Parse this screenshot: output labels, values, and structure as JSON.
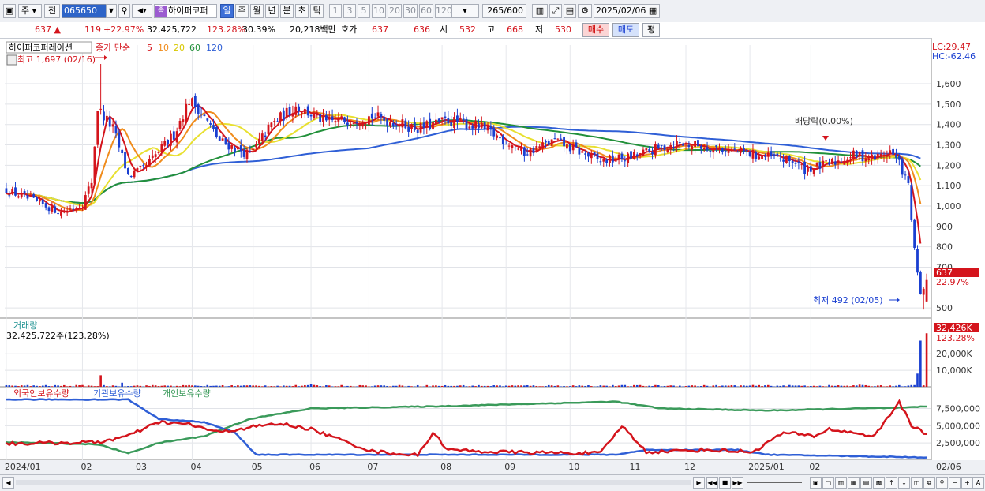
{
  "toolbar": {
    "market_label": "주",
    "board_label": "전",
    "stock_code": "065650",
    "name_tag": "종",
    "stock_name": "하이퍼코퍼",
    "periods": [
      "일",
      "주",
      "월",
      "년",
      "분",
      "초",
      "틱"
    ],
    "selected_period": "일",
    "intervals": [
      "1",
      "3",
      "5",
      "10",
      "20",
      "30",
      "60",
      "120"
    ],
    "count_value": "265",
    "count_total": "/600",
    "date_value": "2025/02/06"
  },
  "infobar": {
    "price": "637 ▲",
    "change": "119",
    "change_rate": "+22.97%",
    "volume": "32,425,722",
    "volume_ratio": "123.28%",
    "turnover": "30.39%",
    "amount": "20,218백만",
    "quote_label": "호가",
    "ask": "637",
    "bid": "636",
    "open_label": "시",
    "open": "532",
    "high_label": "고",
    "high": "668",
    "low_label": "저",
    "low": "530",
    "buy_label": "매수",
    "sell_label": "매도",
    "eval_label": "평"
  },
  "colors": {
    "up": "#d4141c",
    "down": "#1a3fd1",
    "ma5": "#d4141c",
    "ma10": "#f08c1c",
    "ma20": "#e8e030",
    "ma60": "#22903a",
    "ma120": "#2f5fd6",
    "foreign": "#d4141c",
    "institution": "#2f5fd6",
    "individual": "#3a9a5a"
  },
  "chart_data": [
    {
      "type": "candlestick",
      "title": "하이퍼코퍼레이션",
      "ma_label": "종가 단순",
      "ma_periods": [
        "5",
        "10",
        "20",
        "60",
        "120"
      ],
      "ylim": [
        450,
        1790
      ],
      "yticks": [
        "1,600",
        "1,500",
        "1,400",
        "1,300",
        "1,200",
        "1,100",
        "1,000",
        "900",
        "800",
        "700",
        "500"
      ],
      "ytick_values": [
        1600,
        1500,
        1400,
        1300,
        1200,
        1100,
        1000,
        900,
        800,
        700,
        500
      ],
      "lc_label": "LC:29.47",
      "hc_label": "HC:-62.46",
      "last_price_label": "637",
      "last_rate_label": "22.97%",
      "max_annotation": "최고 1,697 (02/16)",
      "min_annotation": "최저 492 (02/05)",
      "dividend_annotation": "배당락(0.00%)",
      "price_keypoints": [
        [
          0,
          1080
        ],
        [
          8,
          1030
        ],
        [
          18,
          970
        ],
        [
          25,
          1010
        ],
        [
          28,
          1120
        ],
        [
          30,
          1480
        ],
        [
          35,
          1380
        ],
        [
          40,
          1150
        ],
        [
          45,
          1180
        ],
        [
          55,
          1350
        ],
        [
          60,
          1520
        ],
        [
          63,
          1480
        ],
        [
          70,
          1320
        ],
        [
          80,
          1250
        ],
        [
          87,
          1400
        ],
        [
          95,
          1490
        ],
        [
          105,
          1410
        ],
        [
          120,
          1440
        ],
        [
          135,
          1380
        ],
        [
          145,
          1420
        ],
        [
          155,
          1390
        ],
        [
          165,
          1310
        ],
        [
          170,
          1260
        ],
        [
          180,
          1320
        ],
        [
          195,
          1220
        ],
        [
          205,
          1240
        ],
        [
          220,
          1310
        ],
        [
          235,
          1280
        ],
        [
          250,
          1240
        ],
        [
          258,
          1220
        ],
        [
          262,
          1180
        ],
        [
          270,
          1205
        ],
        [
          278,
          1250
        ],
        [
          285,
          1235
        ],
        [
          290,
          1270
        ],
        [
          293,
          1210
        ],
        [
          296,
          1100
        ],
        [
          298,
          780
        ],
        [
          300,
          560
        ],
        [
          302,
          637
        ]
      ]
    },
    {
      "type": "bar",
      "title": "거래량",
      "volume_label": "32,425,722주(123.28%)",
      "yticks": [
        "20,000K",
        "10,000K"
      ],
      "ytick_values": [
        20000,
        10000
      ],
      "ylim": [
        0,
        33500
      ],
      "last_volume_label": "32,426K",
      "last_ratio_label": "123.28%",
      "spikes": [
        [
          31,
          7000
        ],
        [
          38,
          2500
        ],
        [
          100,
          1800
        ],
        [
          280,
          1300
        ],
        [
          299,
          8000
        ],
        [
          300,
          28000
        ],
        [
          302,
          32426
        ]
      ]
    },
    {
      "type": "line",
      "series_labels": [
        "외국인보유수량",
        "기관보유수량",
        "개인보유수량"
      ],
      "yticks": [
        "7,500,000",
        "5,000,000",
        "2,500,000"
      ],
      "ytick_values": [
        7500000,
        5000000,
        2500000
      ],
      "ylim": [
        0,
        9500000
      ],
      "foreign_keypoints": [
        [
          0,
          2400000
        ],
        [
          30,
          2600000
        ],
        [
          40,
          3500000
        ],
        [
          50,
          5500000
        ],
        [
          60,
          5200000
        ],
        [
          70,
          4000000
        ],
        [
          80,
          4800000
        ],
        [
          90,
          5300000
        ],
        [
          100,
          4500000
        ],
        [
          120,
          1300000
        ],
        [
          135,
          700000
        ],
        [
          140,
          4000000
        ],
        [
          145,
          1500000
        ],
        [
          160,
          1200000
        ],
        [
          175,
          1100000
        ],
        [
          195,
          1000000
        ],
        [
          202,
          5000000
        ],
        [
          210,
          1200000
        ],
        [
          230,
          1500000
        ],
        [
          245,
          1200000
        ],
        [
          255,
          4000000
        ],
        [
          265,
          3500000
        ],
        [
          270,
          4500000
        ],
        [
          285,
          3500000
        ],
        [
          293,
          8500000
        ],
        [
          297,
          5000000
        ],
        [
          299,
          4500000
        ],
        [
          302,
          3800000
        ]
      ],
      "institution_keypoints": [
        [
          0,
          8800000
        ],
        [
          40,
          8800000
        ],
        [
          50,
          6000000
        ],
        [
          65,
          5500000
        ],
        [
          75,
          4000000
        ],
        [
          82,
          800000
        ],
        [
          120,
          800000
        ],
        [
          200,
          800000
        ],
        [
          210,
          1500000
        ],
        [
          240,
          1500000
        ],
        [
          250,
          800000
        ],
        [
          302,
          400000
        ]
      ],
      "individual_keypoints": [
        [
          0,
          2600000
        ],
        [
          30,
          2300000
        ],
        [
          40,
          1000000
        ],
        [
          50,
          2500000
        ],
        [
          65,
          3500000
        ],
        [
          80,
          6000000
        ],
        [
          100,
          7500000
        ],
        [
          140,
          7800000
        ],
        [
          200,
          8500000
        ],
        [
          215,
          7500000
        ],
        [
          250,
          7200000
        ],
        [
          280,
          7500000
        ],
        [
          295,
          7600000
        ],
        [
          302,
          7800000
        ]
      ]
    }
  ],
  "xaxis": {
    "labels": [
      "2024/01",
      "02",
      "03",
      "04",
      "05",
      "06",
      "07",
      "08",
      "09",
      "10",
      "11",
      "12",
      "2025/01",
      "02",
      "02/06"
    ],
    "positions": [
      0,
      25,
      43,
      61,
      81,
      100,
      119,
      143,
      164,
      185,
      205,
      223,
      244,
      264,
      302
    ]
  }
}
